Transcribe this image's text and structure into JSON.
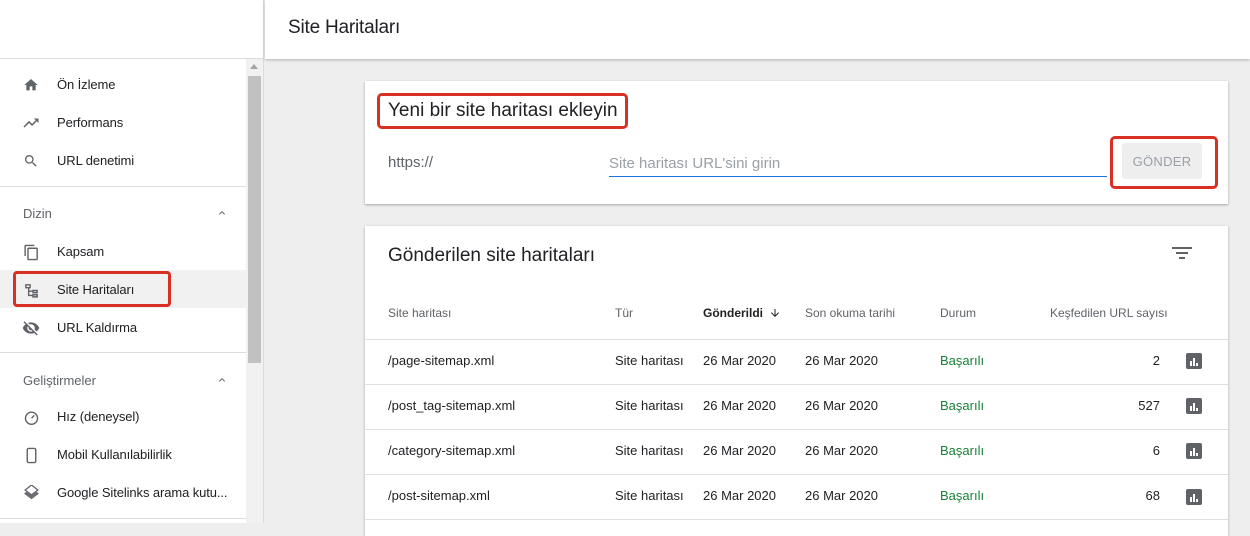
{
  "header": {
    "title": "Site Haritaları"
  },
  "sidebar": {
    "items": [
      {
        "label": "Ön İzleme",
        "icon": "home-icon"
      },
      {
        "label": "Performans",
        "icon": "trending-up-icon"
      },
      {
        "label": "URL denetimi",
        "icon": "search-icon"
      }
    ],
    "sections": [
      {
        "label": "Dizin",
        "items": [
          {
            "label": "Kapsam",
            "icon": "copy-icon"
          },
          {
            "label": "Site Haritaları",
            "icon": "sitemap-icon",
            "active": true
          },
          {
            "label": "URL Kaldırma",
            "icon": "visibility-off-icon"
          }
        ]
      },
      {
        "label": "Geliştirmeler",
        "items": [
          {
            "label": "Hız (deneysel)",
            "icon": "speed-icon"
          },
          {
            "label": "Mobil Kullanılabilirlik",
            "icon": "phone-icon"
          },
          {
            "label": "Google Sitelinks arama kutu...",
            "icon": "layers-icon"
          }
        ]
      }
    ]
  },
  "add_card": {
    "title": "Yeni bir site haritası ekleyin",
    "prefix": "https://",
    "input_value": "",
    "input_placeholder": "Site haritası URL'sini girin",
    "submit_label": "GÖNDER"
  },
  "list_card": {
    "title": "Gönderilen site haritaları",
    "columns": [
      "Site haritası",
      "Tür",
      "Gönderildi",
      "Son okuma tarihi",
      "Durum",
      "Keşfedilen URL sayısı"
    ],
    "sorted_column": "Gönderildi",
    "rows": [
      {
        "sitemap": "/page-sitemap.xml",
        "type": "Site haritası",
        "submitted": "26 Mar 2020",
        "last_read": "26 Mar 2020",
        "status": "Başarılı",
        "urls": "2"
      },
      {
        "sitemap": "/post_tag-sitemap.xml",
        "type": "Site haritası",
        "submitted": "26 Mar 2020",
        "last_read": "26 Mar 2020",
        "status": "Başarılı",
        "urls": "527"
      },
      {
        "sitemap": "/category-sitemap.xml",
        "type": "Site haritası",
        "submitted": "26 Mar 2020",
        "last_read": "26 Mar 2020",
        "status": "Başarılı",
        "urls": "6"
      },
      {
        "sitemap": "/post-sitemap.xml",
        "type": "Site haritası",
        "submitted": "26 Mar 2020",
        "last_read": "26 Mar 2020",
        "status": "Başarılı",
        "urls": "68"
      }
    ]
  },
  "colors": {
    "highlight": "#d93025",
    "success": "#188038",
    "accent": "#1a73e8"
  }
}
